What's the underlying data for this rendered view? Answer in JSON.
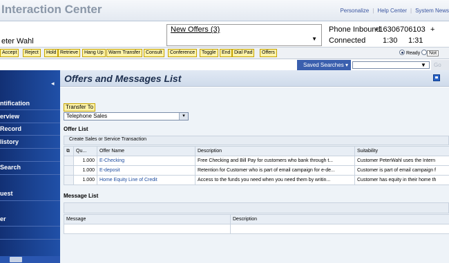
{
  "header": {
    "app_title": "Interaction Center",
    "nav": [
      "Personalize",
      "Help Center",
      "System News"
    ]
  },
  "caller": {
    "name": "eter Wahl",
    "offers_link": "New Offers (3)",
    "channel": "Phone Inbound",
    "number": "+16306706103",
    "number_extra": "+",
    "status": "Connected",
    "timer_1": "1:30",
    "timer_2": "1:31"
  },
  "toolbar": {
    "buttons": [
      "Accept",
      "Reject",
      "Hold",
      "Retrieve",
      "Hang Up",
      "Warm Transfer",
      "Consult",
      "Conference",
      "Toggle",
      "End",
      "Dial Pad",
      "Offers"
    ],
    "ready_label": "Ready",
    "not_label": "Not"
  },
  "saved_searches": {
    "label": "Saved Searches",
    "caret": "▾",
    "input_value": "",
    "go_label": "Go"
  },
  "sidebar": {
    "collapse_icon": "◂",
    "items": [
      "ntification",
      "erview",
      "Record",
      "listory",
      "Search",
      "uest",
      "er"
    ]
  },
  "page": {
    "title": "Offers and Messages List"
  },
  "transfer": {
    "label": "Transfer To",
    "selected": "Telephone Sales",
    "caret": "▾"
  },
  "offer_list": {
    "title": "Offer List",
    "create_label": "Create Sales or Service Transaction",
    "columns": [
      "Qu...",
      "Offer Name",
      "Description",
      "Suitability"
    ],
    "rows": [
      {
        "qty": "1.000",
        "name": "E-Checking",
        "description": "Free Checking and Bill Pay for customers who bank through t...",
        "suitability": "Customer PeterWahl uses the Intern"
      },
      {
        "qty": "1.000",
        "name": "E-deposit",
        "description": "Retention for Customer who is part of email campaign for e-de...",
        "suitability": "Customer is part of email campaign f"
      },
      {
        "qty": "1.000",
        "name": "Home Equity Line of Credit",
        "description": "Access to the funds you need when you need them by writin...",
        "suitability": "Customer has equity in their home th"
      }
    ]
  },
  "message_list": {
    "title": "Message List",
    "columns": [
      "Message",
      "Description"
    ]
  }
}
